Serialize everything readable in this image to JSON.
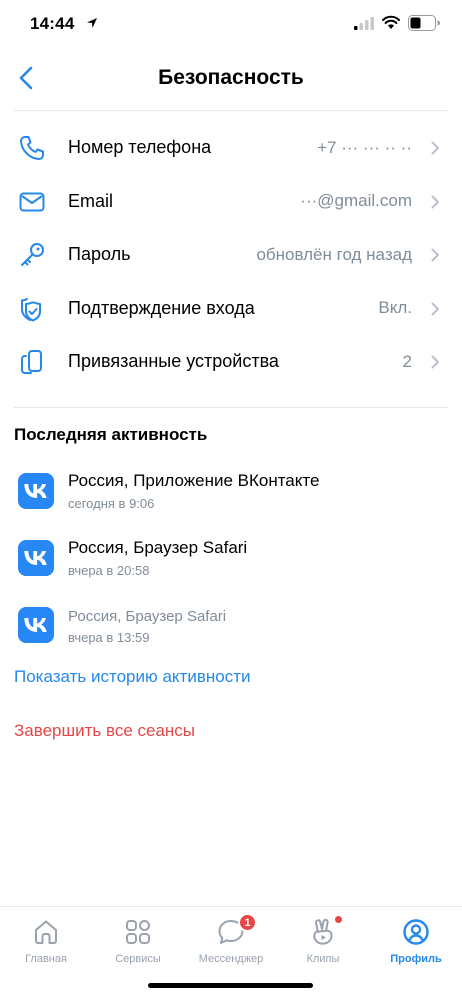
{
  "status_bar": {
    "time": "14:44"
  },
  "header": {
    "title": "Безопасность"
  },
  "settings": [
    {
      "label": "Номер телефона",
      "value": "+7 ··· ··· ·· ··",
      "icon": "phone-icon"
    },
    {
      "label": "Email",
      "value": "···@gmail.com",
      "icon": "mail-icon"
    },
    {
      "label": "Пароль",
      "value": "обновлён год назад",
      "icon": "key-icon"
    },
    {
      "label": "Подтверждение входа",
      "value": "Вкл.",
      "icon": "shield-check-icon"
    },
    {
      "label": "Привязанные устройства",
      "value": "2",
      "icon": "devices-icon"
    }
  ],
  "activity": {
    "title": "Последняя активность",
    "items": [
      {
        "main": "Россия, Приложение ВКонтакте",
        "sub": "сегодня в 9:06"
      },
      {
        "main": "Россия, Браузер Safari",
        "sub": "вчера в 20:58"
      },
      {
        "main": "Россия, Браузер Safari",
        "sub": "вчера в 13:59"
      }
    ],
    "show_history": "Показать историю активности",
    "end_sessions": "Завершить все сеансы"
  },
  "tabbar": {
    "tabs": [
      {
        "label": "Главная",
        "icon": "home-icon"
      },
      {
        "label": "Сервисы",
        "icon": "services-icon"
      },
      {
        "label": "Мессенджер",
        "icon": "messenger-icon",
        "badge": "1"
      },
      {
        "label": "Клипы",
        "icon": "clips-icon"
      },
      {
        "label": "Профиль",
        "icon": "profile-icon"
      }
    ]
  },
  "colors": {
    "accent": "#2688eb",
    "danger": "#e64646",
    "secondary_text": "#818c99",
    "vk_blue": "#2787f5"
  }
}
